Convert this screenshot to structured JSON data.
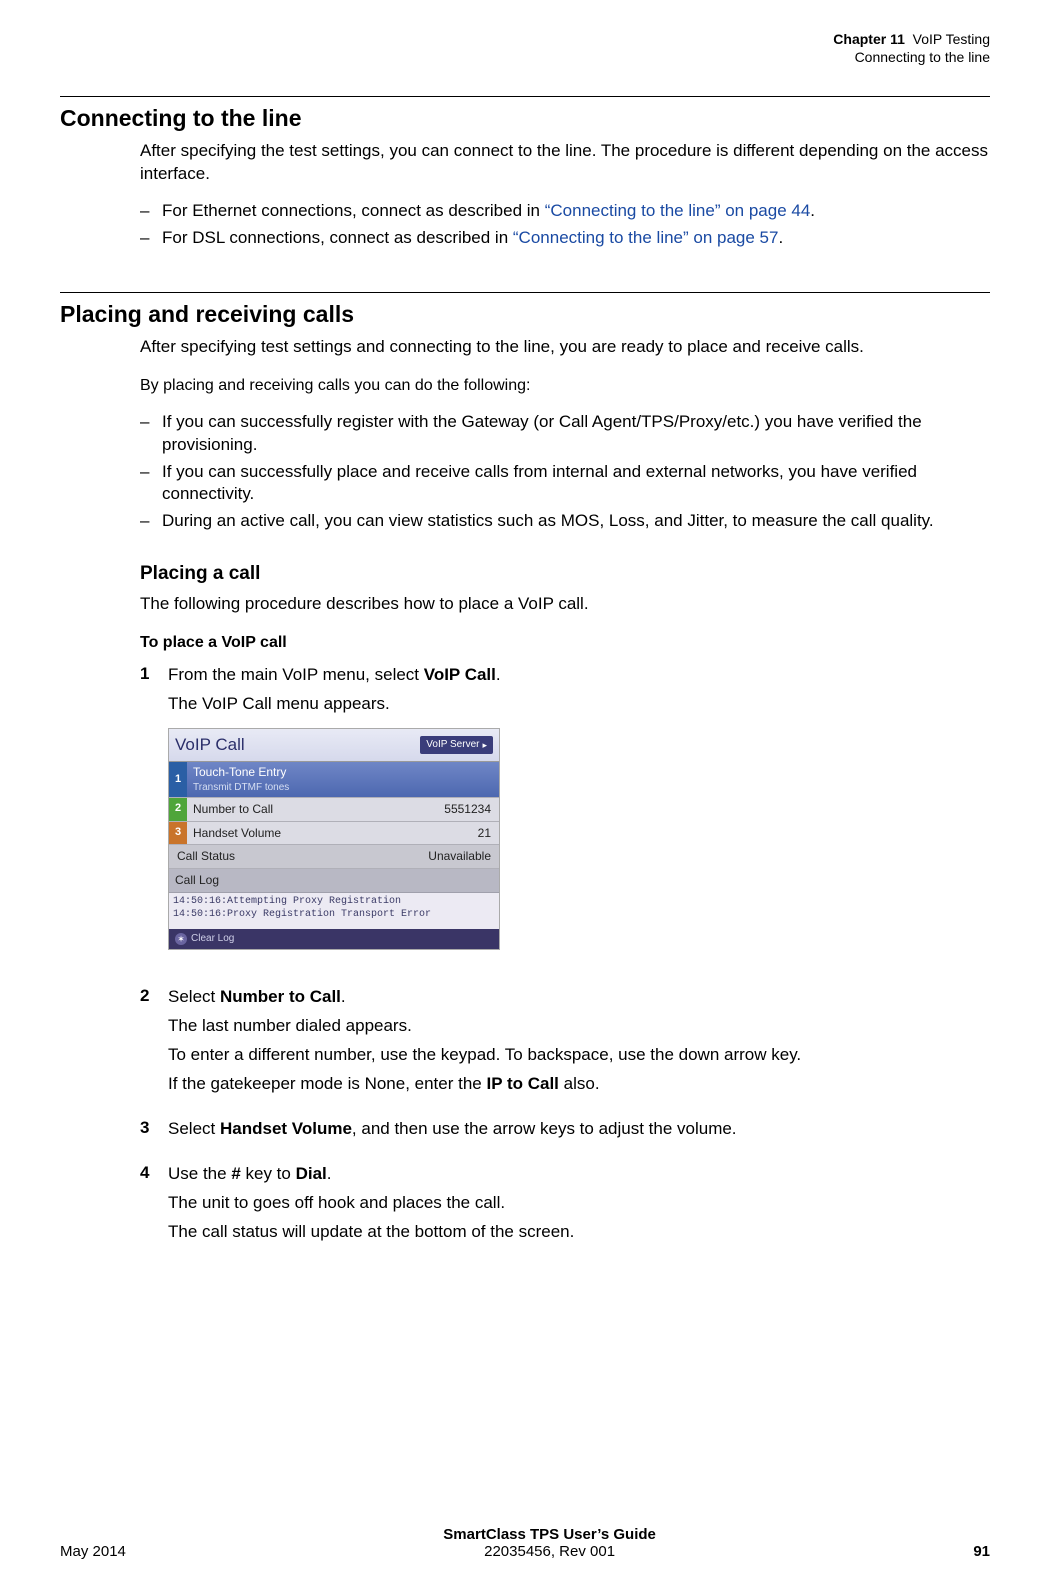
{
  "header": {
    "chapter_label": "Chapter 11",
    "chapter_title": "VoIP Testing",
    "section_crumb": "Connecting to the line"
  },
  "section1": {
    "title": "Connecting to the line",
    "intro": "After specifying the test settings, you can connect to the line. The procedure is different depending on the access interface.",
    "bullets": {
      "b1_pre": "For Ethernet connections, connect as described in ",
      "b1_link": "“Connecting to the line” on page 44",
      "b2_pre": "For DSL connections, connect as described in ",
      "b2_link": "“Connecting to the line” on page 57"
    }
  },
  "section2": {
    "title": "Placing and receiving calls",
    "intro": "After specifying test settings and connecting to the line, you are ready to place and receive calls.",
    "sub_intro": "By placing and receiving calls you can do the following:",
    "bullets": {
      "b1": "If you can successfully register with the Gateway (or Call Agent/TPS/Proxy/etc.) you have verified the provisioning.",
      "b2": "If you can successfully place and receive calls from internal and external networks, you have verified connectivity.",
      "b3": "During an active call, you can view statistics such as MOS, Loss, and Jitter, to measure the call quality."
    },
    "placing": {
      "title": "Placing a call",
      "intro": "The following procedure describes how to place a VoIP call.",
      "proc_title": "To place a VoIP call",
      "steps": {
        "s1": {
          "num": "1",
          "line1_pre": "From the main VoIP menu, select ",
          "line1_bold": "VoIP Call",
          "line2": "The VoIP Call menu appears."
        },
        "s2": {
          "num": "2",
          "line1_pre": "Select ",
          "line1_bold": "Number to Call",
          "line2": "The last number dialed appears.",
          "line3": "To enter a different number, use the keypad. To backspace, use the down arrow key.",
          "line4_pre": "If the gatekeeper mode is None, enter the ",
          "line4_bold": "IP to Call",
          "line4_post": " also."
        },
        "s3": {
          "num": "3",
          "line1_pre": "Select ",
          "line1_bold": "Handset Volume",
          "line1_post": ", and then use the arrow keys to adjust the volume."
        },
        "s4": {
          "num": "4",
          "line1_pre": "Use the ",
          "line1_bold1": "#",
          "line1_mid": " key to ",
          "line1_bold2": "Dial",
          "line2": "The unit to goes off hook and places the call.",
          "line3": "The call status will update at the bottom of the screen."
        }
      }
    }
  },
  "voip_widget": {
    "title": "VoIP Call",
    "softkey": "VoIP Server",
    "row1": {
      "num": "1",
      "label": "Touch-Tone Entry",
      "sublabel": "Transmit DTMF tones"
    },
    "row2": {
      "num": "2",
      "label": "Number to Call",
      "value": "5551234"
    },
    "row3": {
      "num": "3",
      "label": "Handset Volume",
      "value": "21"
    },
    "row4": {
      "label": "Call Status",
      "value": "Unavailable"
    },
    "row5": {
      "label": "Call Log"
    },
    "log": {
      "l1": "14:50:16:Attempting Proxy Registration",
      "l2": "14:50:16:Proxy Registration Transport Error"
    },
    "footer": "Clear Log"
  },
  "footer": {
    "date": "May 2014",
    "title": "SmartClass TPS User’s Guide",
    "docnum": "22035456, Rev 001",
    "page": "91"
  }
}
